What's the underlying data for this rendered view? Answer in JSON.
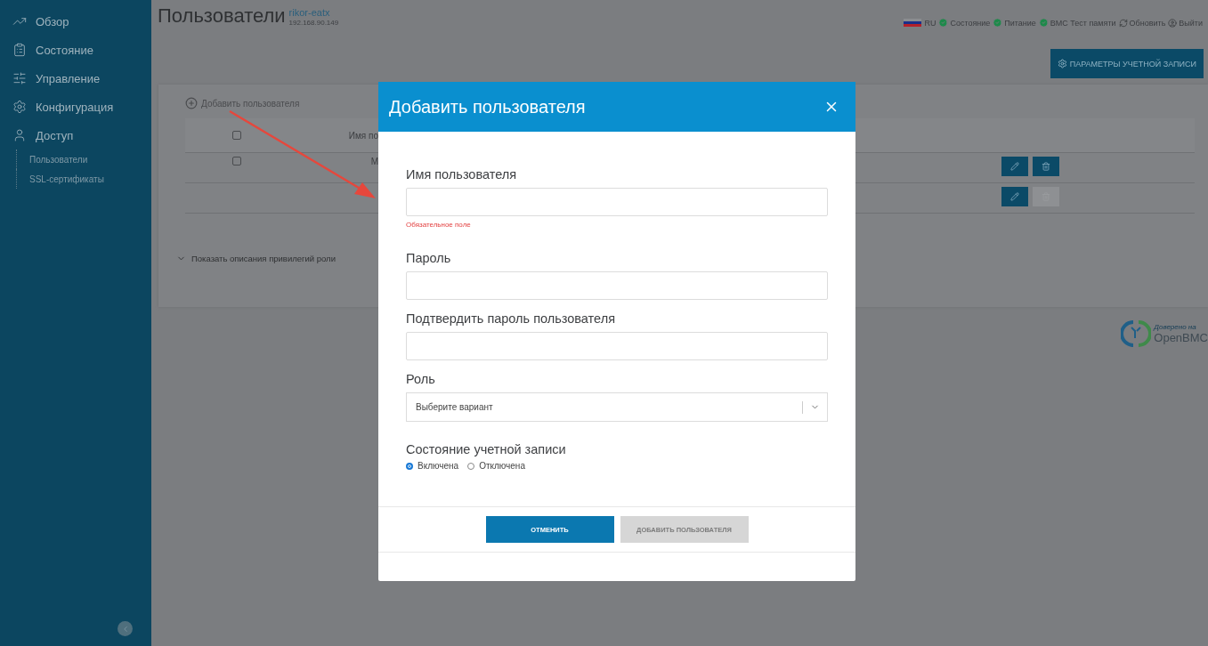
{
  "sidebar": {
    "items": [
      {
        "label": "Обзор"
      },
      {
        "label": "Состояние"
      },
      {
        "label": "Управление"
      },
      {
        "label": "Конфигурация"
      },
      {
        "label": "Доступ",
        "children": [
          {
            "label": "Пользователи"
          },
          {
            "label": "SSL-сертификаты"
          }
        ]
      }
    ]
  },
  "header": {
    "title": "Пользователи",
    "host": "rikor-eatx",
    "ip": "192.168.90.149",
    "language": "RU",
    "indicators": [
      {
        "label": "Состояние",
        "ok": true
      },
      {
        "label": "Питание",
        "ok": true
      },
      {
        "label": "BMC Тест памяти",
        "ok": true
      }
    ],
    "actions": [
      {
        "kind": "refresh",
        "label": "Обновить"
      },
      {
        "kind": "logout",
        "label": "Выйти"
      }
    ]
  },
  "account_button": "ПАРАМЕТРЫ УЧЕТНОЙ ЗАПИСИ",
  "users_panel": {
    "add_link": "Добавить пользователя",
    "table": {
      "header_checked": false,
      "column_2": "Имя по",
      "rows": [
        {
          "checked": false,
          "column_2": "М",
          "delete_disabled": false
        },
        {
          "delete_disabled": true
        }
      ]
    },
    "role_toggle": {
      "label": "Показать описания привилегий роли",
      "expanded": false
    }
  },
  "logo": {
    "caption": "Доверено на",
    "name": "OpenBMC"
  },
  "modal": {
    "title": "Добавить пользователя",
    "fields": [
      {
        "kind": "text",
        "label": "Имя пользователя",
        "error": "Обязательное поле"
      },
      {
        "kind": "password",
        "label": "Пароль"
      },
      {
        "kind": "password",
        "label": "Подтвердить пароль пользователя"
      },
      {
        "kind": "select",
        "label": "Роль",
        "placeholder": "Выберите вариант"
      },
      {
        "kind": "radio",
        "label": "Состояние учетной записи",
        "options": [
          {
            "label": "Включена",
            "selected": true
          },
          {
            "label": "Отключена",
            "selected": false
          }
        ]
      }
    ],
    "buttons": [
      {
        "label": "ОТМЕНИТЬ",
        "disabled": false
      },
      {
        "label": "ДОБАВИТЬ ПОЛЬЗОВАТЕЛЯ",
        "disabled": true
      }
    ]
  }
}
